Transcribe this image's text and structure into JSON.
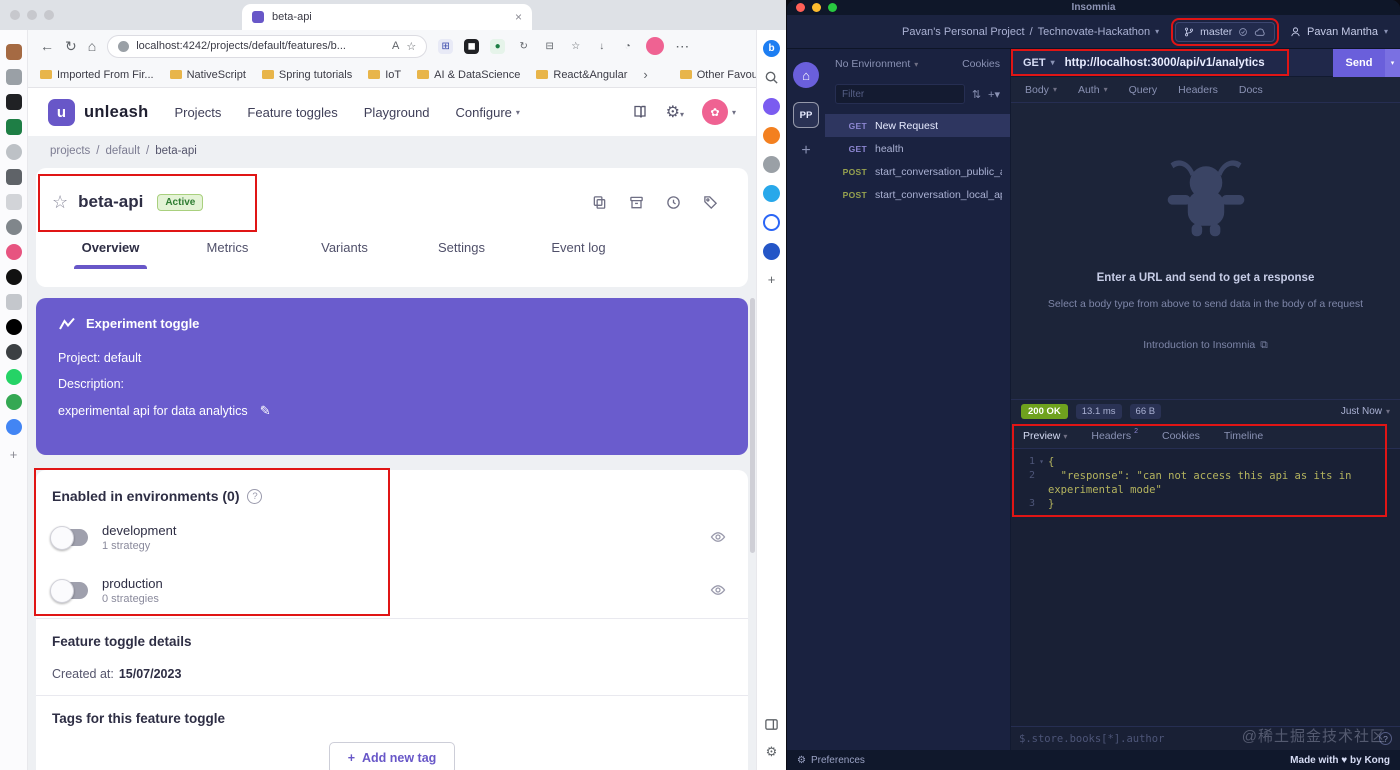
{
  "colors": {
    "unleash_purple": "#6857c8",
    "insomnia_purple": "#6a5fdb",
    "annotation_red": "#e01515",
    "success_green": "#6fa21e"
  },
  "browser": {
    "tab_title": "beta-api",
    "url": "localhost:4242/projects/default/features/b...",
    "read_aloud_icon": "A",
    "bookmarks": [
      "Imported From Fir...",
      "NativeScript",
      "Spring tutorials",
      "IoT",
      "AI & DataScience",
      "React&Angular"
    ],
    "other_favourites": "Other Favourites"
  },
  "unleash": {
    "logo_letter": "u",
    "brand": "unleash",
    "nav": [
      "Projects",
      "Feature toggles",
      "Playground",
      "Configure"
    ],
    "breadcrumb": [
      "projects",
      "default",
      "beta-api"
    ],
    "feature_name": "beta-api",
    "feature_status": "Active",
    "tabs": [
      "Overview",
      "Metrics",
      "Variants",
      "Settings",
      "Event log"
    ],
    "toggle_card": {
      "type_label": "Experiment toggle",
      "project": "Project: default",
      "description_label": "Description:",
      "description": "experimental api for data analytics"
    },
    "environments": {
      "title": "Enabled in environments (0)",
      "items": [
        {
          "name": "development",
          "strategies": "1 strategy"
        },
        {
          "name": "production",
          "strategies": "0 strategies"
        }
      ]
    },
    "details_title": "Feature toggle details",
    "created_label": "Created at:",
    "created_value": "15/07/2023",
    "tags_title": "Tags for this feature toggle",
    "add_tag_label": "Add new tag"
  },
  "insomnia": {
    "window_title": "Insomnia",
    "project": "Pavan's Personal Project",
    "crumb_sep": "/",
    "workspace": "Technovate-Hackathon",
    "branch": "master",
    "user": "Pavan Mantha",
    "home_initials": "PP",
    "environment": "No Environment",
    "cookies": "Cookies",
    "filter_placeholder": "Filter",
    "requests": [
      {
        "method": "GET",
        "name": "New Request"
      },
      {
        "method": "GET",
        "name": "health"
      },
      {
        "method": "POST",
        "name": "start_conversation_public_api"
      },
      {
        "method": "POST",
        "name": "start_conversation_local_api"
      }
    ],
    "request": {
      "method": "GET",
      "url": "http://localhost:3000/api/v1/analytics",
      "send_label": "Send"
    },
    "request_tabs": [
      "Body",
      "Auth",
      "Query",
      "Headers",
      "Docs"
    ],
    "empty": {
      "title": "Enter a URL and send to get a response",
      "subtitle": "Select a body type from above to send data in the body of a request",
      "link": "Introduction to Insomnia"
    },
    "response": {
      "status": "200 OK",
      "time": "13.1 ms",
      "size": "66 B",
      "when": "Just Now",
      "tabs": [
        "Preview",
        "Headers",
        "Cookies",
        "Timeline"
      ],
      "headers_badge": "2",
      "lines": [
        {
          "num": "1",
          "code": "{"
        },
        {
          "num": "2",
          "code": "  \"response\": \"can not access this api as its in experimental mode\""
        },
        {
          "num": "3",
          "code": "}"
        }
      ],
      "filter_placeholder": "$.store.books[*].author"
    },
    "footer_left": "Preferences",
    "footer_right": "Made with ♥ by Kong",
    "watermark": "@稀土掘金技术社区"
  }
}
